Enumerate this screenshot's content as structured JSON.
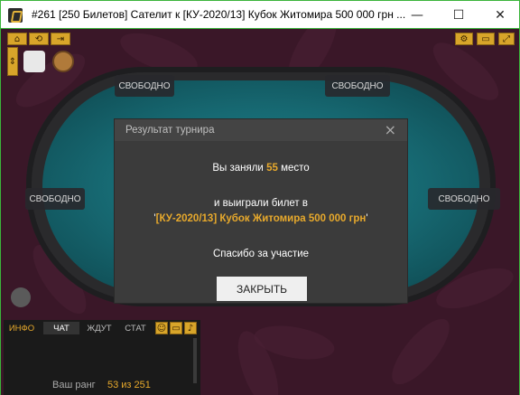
{
  "window": {
    "title": "#261 [250 Билетов] Сателит к [КУ-2020/13] Кубок Житомира 500 000 грн ...",
    "minimize": "—",
    "maximize": "☐",
    "close": "✕"
  },
  "seats": [
    "СВОБОДНО",
    "СВОБОДНО",
    "СВОБОДНО",
    "СВОБОДНО"
  ],
  "modal": {
    "title": "Результат турнира",
    "line1_prefix": "Вы заняли",
    "place": "55",
    "line1_suffix": "место",
    "line2": "и выиграли билет в",
    "ticket_open": "'",
    "ticket_name": "[КУ-2020/13] Кубок Житомира 500 000 грн",
    "ticket_close": "'",
    "thanks": "Спасибо за участие",
    "close_label": "ЗАКРЫТЬ"
  },
  "chat": {
    "tabs": [
      "ИНФО",
      "ЧАТ",
      "ЖДУТ",
      "СТАТ"
    ],
    "rank_label": "Ваш ранг",
    "rank_value": "53 из 251"
  },
  "colors": {
    "accent": "#e7a92c",
    "felt": "#1f8a93",
    "background": "#3a1728"
  }
}
